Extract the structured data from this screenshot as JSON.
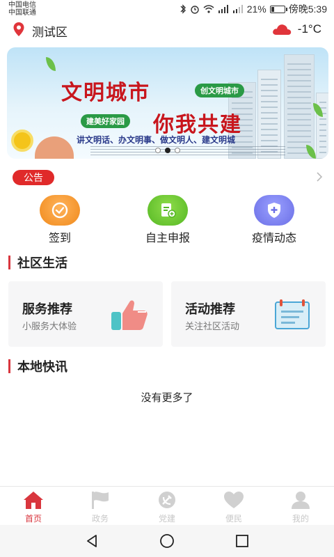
{
  "status_bar": {
    "carrier1": "中国电信",
    "carrier2": "中国联通",
    "battery_percent": "21%",
    "battery_level": 0.21,
    "time": "傍晚5:39",
    "icons": [
      "bluetooth-icon",
      "alarm-icon",
      "wifi-icon",
      "signal-4g-icon",
      "signal-2g-icon",
      "battery-icon"
    ]
  },
  "topbar": {
    "location": "测试区",
    "temperature": "-1°C",
    "location_icon": "map-pin-icon",
    "weather_icon": "cloud-icon"
  },
  "banner": {
    "title_line1": "文明城市",
    "title_line2": "你我共建",
    "pill1": "创文明城市",
    "pill2": "建美好家园",
    "slogan": "讲文明话、办文明事、做文明人、建文明城",
    "slides": 3,
    "active_slide": 1
  },
  "notice": {
    "badge": "公告",
    "arrow_icon": "chevron-right-icon"
  },
  "quick_actions": [
    {
      "label": "签到",
      "icon": "sign-in-icon",
      "color": "#f08a1c"
    },
    {
      "label": "自主申报",
      "icon": "declare-icon",
      "color": "#55b824"
    },
    {
      "label": "疫情动态",
      "icon": "shield-plus-icon",
      "color": "#6b6fe6"
    }
  ],
  "community": {
    "title": "社区生活",
    "cards": [
      {
        "title": "服务推荐",
        "subtitle": "小服务大体验",
        "icon": "thumbs-up-icon"
      },
      {
        "title": "活动推荐",
        "subtitle": "关注社区活动",
        "icon": "notice-board-icon"
      }
    ]
  },
  "news": {
    "title": "本地快讯",
    "empty_text": "没有更多了"
  },
  "tabs": [
    {
      "label": "首页",
      "icon": "home-icon",
      "active": true
    },
    {
      "label": "政务",
      "icon": "flag-icon",
      "active": false
    },
    {
      "label": "党建",
      "icon": "party-emblem-icon",
      "active": false
    },
    {
      "label": "便民",
      "icon": "heart-icon",
      "active": false
    },
    {
      "label": "我的",
      "icon": "user-icon",
      "active": false
    }
  ],
  "colors": {
    "accent": "#d9363e",
    "notice_badge": "#e02a2a",
    "tab_inactive": "#c8c8c8"
  }
}
